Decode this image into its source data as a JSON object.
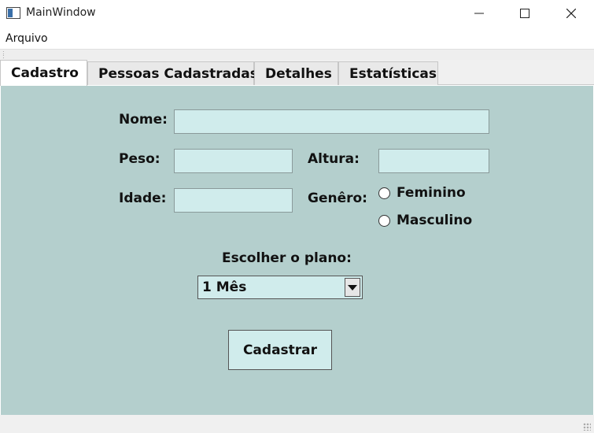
{
  "window": {
    "title": "MainWindow",
    "icons": {
      "app": "window-app-icon",
      "minimize": "minimize-icon",
      "maximize": "maximize-icon",
      "close": "close-icon"
    }
  },
  "menu": {
    "items": [
      "Arquivo"
    ]
  },
  "tabs": [
    {
      "label": "Cadastro",
      "active": true
    },
    {
      "label": "Pessoas Cadastradas",
      "active": false
    },
    {
      "label": "Detalhes",
      "active": false
    },
    {
      "label": "Estatísticas",
      "active": false
    }
  ],
  "form": {
    "nome_label": "Nome:",
    "nome_value": "",
    "peso_label": "Peso:",
    "peso_value": "",
    "altura_label": "Altura:",
    "altura_value": "",
    "idade_label": "Idade:",
    "idade_value": "",
    "genero_label": "Genêro:",
    "genero_options": [
      "Feminino",
      "Masculino"
    ],
    "genero_selected": null,
    "plano_label": "Escolher o plano:",
    "plano_selected": "1 Mês",
    "submit_label": "Cadastrar"
  },
  "colors": {
    "panel_bg": "#b4cfcd",
    "field_bg": "#d0ecec"
  }
}
